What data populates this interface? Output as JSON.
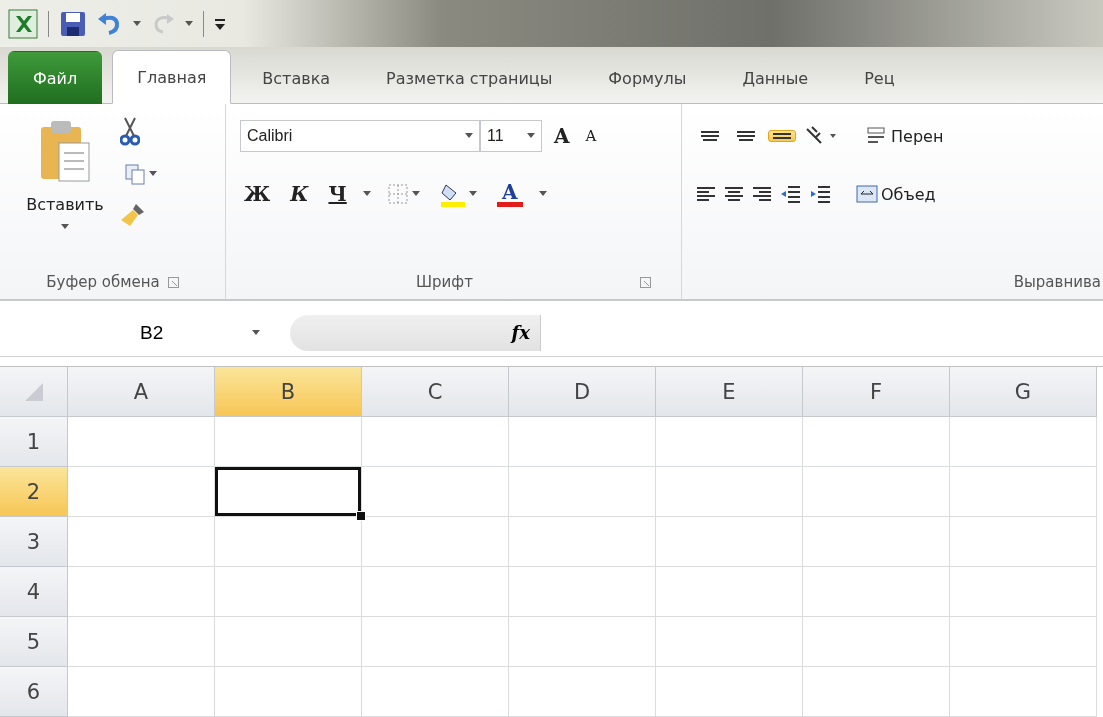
{
  "tabs": [
    {
      "label": "Файл",
      "kind": "file",
      "selected": false
    },
    {
      "label": "Главная",
      "kind": "tab",
      "selected": true
    },
    {
      "label": "Вставка",
      "kind": "tab",
      "selected": false
    },
    {
      "label": "Разметка страницы",
      "kind": "tab",
      "selected": false
    },
    {
      "label": "Формулы",
      "kind": "tab",
      "selected": false
    },
    {
      "label": "Данные",
      "kind": "tab",
      "selected": false
    },
    {
      "label": "Рец",
      "kind": "tab",
      "selected": false
    }
  ],
  "clipboard": {
    "paste": "Вставить",
    "label": "Буфер обмена"
  },
  "font": {
    "name": "Calibri",
    "size": "11",
    "grow": "A",
    "shrink": "A",
    "bold": "Ж",
    "italic": "К",
    "underline": "Ч",
    "color_letter": "A",
    "label": "Шрифт"
  },
  "alignment": {
    "vertical": [
      {
        "selected": false
      },
      {
        "selected": false
      },
      {
        "selected": true
      }
    ],
    "wrap": "Перен",
    "merge": "Объед",
    "label": "Выравнива"
  },
  "formula_bar": {
    "name_box": "B2",
    "fx": "fx"
  },
  "columns": [
    {
      "label": "A",
      "selected": false
    },
    {
      "label": "B",
      "selected": true
    },
    {
      "label": "C",
      "selected": false
    },
    {
      "label": "D",
      "selected": false
    },
    {
      "label": "E",
      "selected": false
    },
    {
      "label": "F",
      "selected": false
    },
    {
      "label": "G",
      "selected": false
    }
  ],
  "rows": [
    {
      "label": "1",
      "selected": false
    },
    {
      "label": "2",
      "selected": true
    },
    {
      "label": "3",
      "selected": false
    },
    {
      "label": "4",
      "selected": false
    },
    {
      "label": "5",
      "selected": false
    },
    {
      "label": "6",
      "selected": false
    }
  ]
}
